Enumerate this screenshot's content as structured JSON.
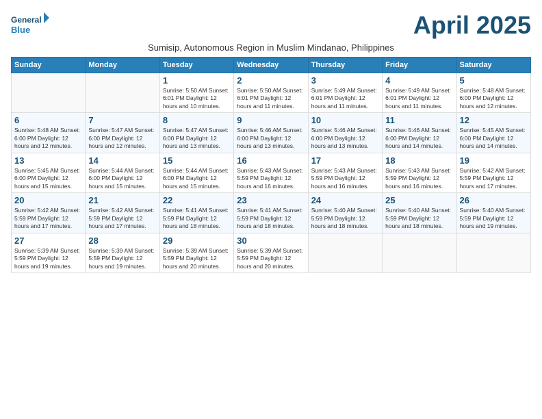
{
  "logo": {
    "line1": "General",
    "line2": "Blue"
  },
  "title": "April 2025",
  "subtitle": "Sumisip, Autonomous Region in Muslim Mindanao, Philippines",
  "weekdays": [
    "Sunday",
    "Monday",
    "Tuesday",
    "Wednesday",
    "Thursday",
    "Friday",
    "Saturday"
  ],
  "weeks": [
    [
      {
        "day": "",
        "info": ""
      },
      {
        "day": "",
        "info": ""
      },
      {
        "day": "1",
        "info": "Sunrise: 5:50 AM\nSunset: 6:01 PM\nDaylight: 12 hours and 10 minutes."
      },
      {
        "day": "2",
        "info": "Sunrise: 5:50 AM\nSunset: 6:01 PM\nDaylight: 12 hours and 11 minutes."
      },
      {
        "day": "3",
        "info": "Sunrise: 5:49 AM\nSunset: 6:01 PM\nDaylight: 12 hours and 11 minutes."
      },
      {
        "day": "4",
        "info": "Sunrise: 5:49 AM\nSunset: 6:01 PM\nDaylight: 12 hours and 11 minutes."
      },
      {
        "day": "5",
        "info": "Sunrise: 5:48 AM\nSunset: 6:00 PM\nDaylight: 12 hours and 12 minutes."
      }
    ],
    [
      {
        "day": "6",
        "info": "Sunrise: 5:48 AM\nSunset: 6:00 PM\nDaylight: 12 hours and 12 minutes."
      },
      {
        "day": "7",
        "info": "Sunrise: 5:47 AM\nSunset: 6:00 PM\nDaylight: 12 hours and 12 minutes."
      },
      {
        "day": "8",
        "info": "Sunrise: 5:47 AM\nSunset: 6:00 PM\nDaylight: 12 hours and 13 minutes."
      },
      {
        "day": "9",
        "info": "Sunrise: 5:46 AM\nSunset: 6:00 PM\nDaylight: 12 hours and 13 minutes."
      },
      {
        "day": "10",
        "info": "Sunrise: 5:46 AM\nSunset: 6:00 PM\nDaylight: 12 hours and 13 minutes."
      },
      {
        "day": "11",
        "info": "Sunrise: 5:46 AM\nSunset: 6:00 PM\nDaylight: 12 hours and 14 minutes."
      },
      {
        "day": "12",
        "info": "Sunrise: 5:45 AM\nSunset: 6:00 PM\nDaylight: 12 hours and 14 minutes."
      }
    ],
    [
      {
        "day": "13",
        "info": "Sunrise: 5:45 AM\nSunset: 6:00 PM\nDaylight: 12 hours and 15 minutes."
      },
      {
        "day": "14",
        "info": "Sunrise: 5:44 AM\nSunset: 6:00 PM\nDaylight: 12 hours and 15 minutes."
      },
      {
        "day": "15",
        "info": "Sunrise: 5:44 AM\nSunset: 6:00 PM\nDaylight: 12 hours and 15 minutes."
      },
      {
        "day": "16",
        "info": "Sunrise: 5:43 AM\nSunset: 5:59 PM\nDaylight: 12 hours and 16 minutes."
      },
      {
        "day": "17",
        "info": "Sunrise: 5:43 AM\nSunset: 5:59 PM\nDaylight: 12 hours and 16 minutes."
      },
      {
        "day": "18",
        "info": "Sunrise: 5:43 AM\nSunset: 5:59 PM\nDaylight: 12 hours and 16 minutes."
      },
      {
        "day": "19",
        "info": "Sunrise: 5:42 AM\nSunset: 5:59 PM\nDaylight: 12 hours and 17 minutes."
      }
    ],
    [
      {
        "day": "20",
        "info": "Sunrise: 5:42 AM\nSunset: 5:59 PM\nDaylight: 12 hours and 17 minutes."
      },
      {
        "day": "21",
        "info": "Sunrise: 5:42 AM\nSunset: 5:59 PM\nDaylight: 12 hours and 17 minutes."
      },
      {
        "day": "22",
        "info": "Sunrise: 5:41 AM\nSunset: 5:59 PM\nDaylight: 12 hours and 18 minutes."
      },
      {
        "day": "23",
        "info": "Sunrise: 5:41 AM\nSunset: 5:59 PM\nDaylight: 12 hours and 18 minutes."
      },
      {
        "day": "24",
        "info": "Sunrise: 5:40 AM\nSunset: 5:59 PM\nDaylight: 12 hours and 18 minutes."
      },
      {
        "day": "25",
        "info": "Sunrise: 5:40 AM\nSunset: 5:59 PM\nDaylight: 12 hours and 18 minutes."
      },
      {
        "day": "26",
        "info": "Sunrise: 5:40 AM\nSunset: 5:59 PM\nDaylight: 12 hours and 19 minutes."
      }
    ],
    [
      {
        "day": "27",
        "info": "Sunrise: 5:39 AM\nSunset: 5:59 PM\nDaylight: 12 hours and 19 minutes."
      },
      {
        "day": "28",
        "info": "Sunrise: 5:39 AM\nSunset: 5:59 PM\nDaylight: 12 hours and 19 minutes."
      },
      {
        "day": "29",
        "info": "Sunrise: 5:39 AM\nSunset: 5:59 PM\nDaylight: 12 hours and 20 minutes."
      },
      {
        "day": "30",
        "info": "Sunrise: 5:39 AM\nSunset: 5:59 PM\nDaylight: 12 hours and 20 minutes."
      },
      {
        "day": "",
        "info": ""
      },
      {
        "day": "",
        "info": ""
      },
      {
        "day": "",
        "info": ""
      }
    ]
  ]
}
